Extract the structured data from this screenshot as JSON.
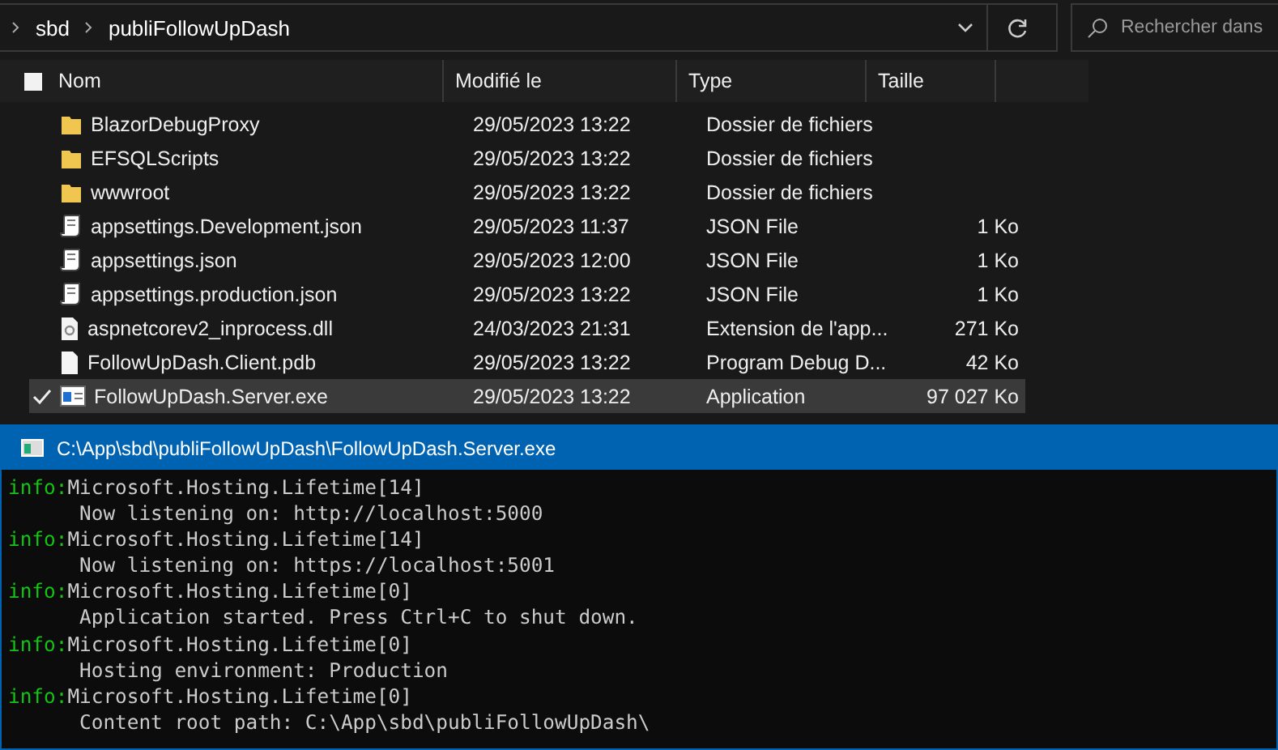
{
  "breadcrumb": [
    "sbd",
    "publiFollowUpDash"
  ],
  "search": {
    "placeholder": "Rechercher dans"
  },
  "header": {
    "checked": false,
    "columns": [
      "Nom",
      "Modifié le",
      "Type",
      "Taille"
    ]
  },
  "files": [
    {
      "kind": "folder",
      "name": "BlazorDebugProxy",
      "modified": "29/05/2023 13:22",
      "type": "Dossier de fichiers",
      "selected": false
    },
    {
      "kind": "folder",
      "name": "EFSQLScripts",
      "modified": "29/05/2023 13:22",
      "type": "Dossier de fichiers",
      "selected": false
    },
    {
      "kind": "folder",
      "name": "wwwroot",
      "modified": "29/05/2023 13:22",
      "type": "Dossier de fichiers",
      "selected": false
    },
    {
      "kind": "json",
      "name": "appsettings.Development.json",
      "modified": "29/05/2023 11:37",
      "type": "JSON File",
      "size": "1 Ko",
      "selected": false
    },
    {
      "kind": "json",
      "name": "appsettings.json",
      "modified": "29/05/2023 12:00",
      "type": "JSON File",
      "size": "1 Ko",
      "selected": false
    },
    {
      "kind": "json",
      "name": "appsettings.production.json",
      "modified": "29/05/2023 13:22",
      "type": "JSON File",
      "size": "1 Ko",
      "selected": false
    },
    {
      "kind": "dll",
      "name": "aspnetcorev2_inprocess.dll",
      "modified": "24/03/2023 21:31",
      "type": "Extension de l'app...",
      "size": "271 Ko",
      "selected": false
    },
    {
      "kind": "file",
      "name": "FollowUpDash.Client.pdb",
      "modified": "29/05/2023 13:22",
      "type": "Program Debug D...",
      "size": "42 Ko",
      "selected": false
    },
    {
      "kind": "exe",
      "name": "FollowUpDash.Server.exe",
      "modified": "29/05/2023 13:22",
      "type": "Application",
      "size": "97 027 Ko",
      "selected": true
    }
  ],
  "console": {
    "title": "C:\\App\\sbd\\publiFollowUpDash\\FollowUpDash.Server.exe",
    "lines": [
      {
        "kind": "info",
        "level": "info:",
        "text": "Microsoft.Hosting.Lifetime[14]"
      },
      {
        "kind": "detail",
        "text": "Now listening on: http://localhost:5000"
      },
      {
        "kind": "info",
        "level": "info:",
        "text": "Microsoft.Hosting.Lifetime[14]"
      },
      {
        "kind": "detail",
        "text": "Now listening on: https://localhost:5001"
      },
      {
        "kind": "info",
        "level": "info:",
        "text": "Microsoft.Hosting.Lifetime[0]"
      },
      {
        "kind": "detail",
        "text": "Application started. Press Ctrl+C to shut down."
      },
      {
        "kind": "info",
        "level": "info:",
        "text": "Microsoft.Hosting.Lifetime[0]"
      },
      {
        "kind": "detail",
        "text": "Hosting environment: Production"
      },
      {
        "kind": "info",
        "level": "info:",
        "text": "Microsoft.Hosting.Lifetime[0]"
      },
      {
        "kind": "detail",
        "text": "Content root path: C:\\App\\sbd\\publiFollowUpDash\\"
      }
    ]
  }
}
